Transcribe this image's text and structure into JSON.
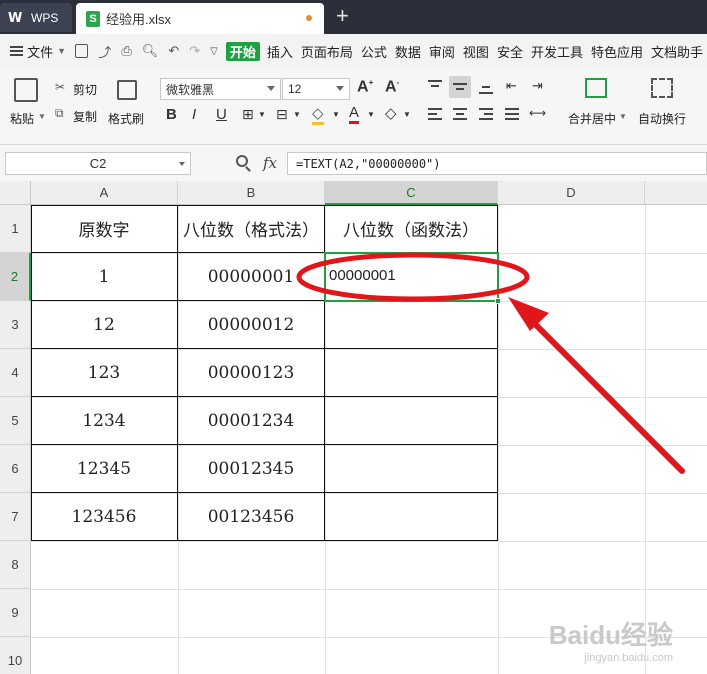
{
  "titlebar": {
    "app_tab": "WPS",
    "file_tab": "经验用.xlsx",
    "new_tab": "+"
  },
  "menubar": {
    "file_menu": "文件",
    "tabs": [
      "开始",
      "插入",
      "页面布局",
      "公式",
      "数据",
      "审阅",
      "视图",
      "安全",
      "开发工具",
      "特色应用",
      "文档助手"
    ]
  },
  "ribbon": {
    "paste": "粘贴",
    "cut": "剪切",
    "copy": "复制",
    "format_painter": "格式刷",
    "font_name": "微软雅黑",
    "font_size": "12",
    "merge_center": "合并居中",
    "wrap_text": "自动换行"
  },
  "formula": {
    "name_box": "C2",
    "fx": "fx",
    "content": "=TEXT(A2,\"00000000\")"
  },
  "sheet": {
    "columns": [
      "A",
      "B",
      "C",
      "D"
    ],
    "rows": [
      "1",
      "2",
      "3",
      "4",
      "5",
      "6",
      "7",
      "8",
      "9",
      "10"
    ],
    "active_cell": "C2",
    "cells": {
      "A1": "原数字",
      "B1": "八位数（格式法）",
      "C1": "八位数（函数法）",
      "A2": "1",
      "B2": "00000001",
      "C2": "00000001",
      "A3": "12",
      "B3": "00000012",
      "A4": "123",
      "B4": "00000123",
      "A5": "1234",
      "B5": "00001234",
      "A6": "12345",
      "B6": "00012345",
      "A7": "123456",
      "B7": "00123456"
    }
  },
  "annotation": {
    "color": "#e0161b"
  },
  "watermark": {
    "brand": "Baidu经验",
    "url": "jingyan.baidu.com"
  },
  "colors": {
    "accent": "#1fa044",
    "titlebar": "#2b2f3a"
  }
}
